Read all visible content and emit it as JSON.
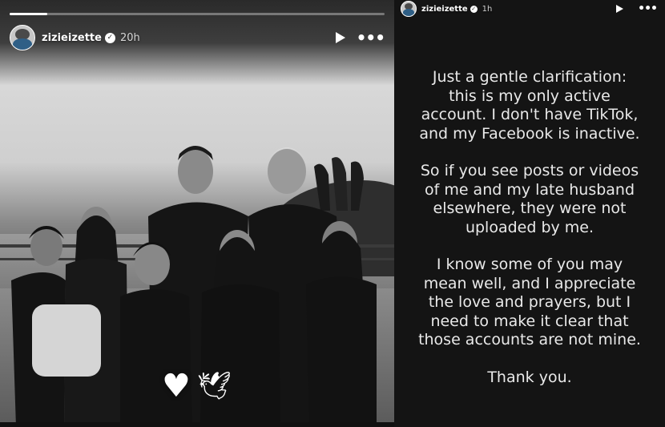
{
  "left_story": {
    "username": "zizieizette",
    "time_ago": "20h",
    "progress": 0.1,
    "stickers": {
      "heart": "♥",
      "dove": "🕊"
    }
  },
  "right_story": {
    "username": "zizieizette",
    "time_ago": "1h",
    "paragraphs": [
      "Just a gentle clarification: this is my only active account. I don't have TikTok, and my Facebook is inactive.",
      "So if you see posts or videos of me and my late husband elsewhere, they were not uploaded by me.",
      "I know some of you may mean well, and I appreciate the love and prayers, but I need to make it clear that those accounts are not mine.",
      "Thank you."
    ]
  },
  "icons": {
    "verified": "✓",
    "more": "•••"
  }
}
